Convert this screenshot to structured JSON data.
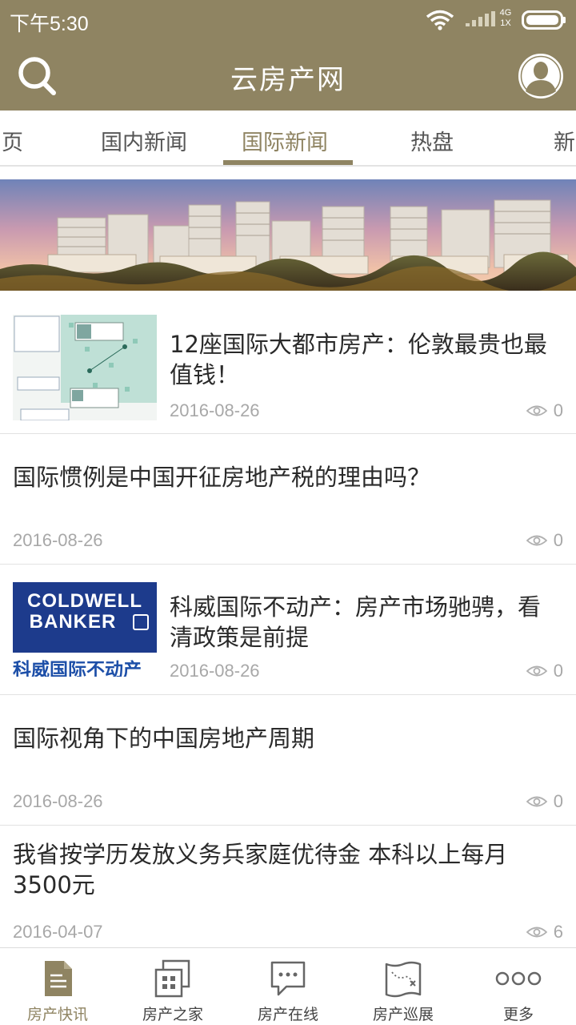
{
  "status_bar": {
    "time": "下午5:30",
    "network_top": "4G",
    "network_bottom": "1X"
  },
  "header": {
    "title": "云房产网",
    "accent_color": "#8f8462"
  },
  "tabs": [
    {
      "label": "页",
      "active": false
    },
    {
      "label": "国内新闻",
      "active": false
    },
    {
      "label": "国际新闻",
      "active": true
    },
    {
      "label": "热盘",
      "active": false
    },
    {
      "label": "新",
      "active": false
    }
  ],
  "news": [
    {
      "title": "12座国际大都市房产：伦敦最贵也最值钱！",
      "date": "2016-08-26",
      "views": "0",
      "thumbnail": "map-infographic"
    },
    {
      "title": "国际惯例是中国开征房地产税的理由吗？",
      "date": "2016-08-26",
      "views": "0"
    },
    {
      "title": "科威国际不动产：房产市场驰骋，看清政策是前提",
      "date": "2016-08-26",
      "views": "0",
      "thumbnail": "coldwell-banker-logo",
      "logo": {
        "line1": "COLDWELL",
        "line2": "BANKER",
        "caption": "科威国际不动产"
      }
    },
    {
      "title": "国际视角下的中国房地产周期",
      "date": "2016-08-26",
      "views": "0"
    },
    {
      "title": "我省按学历发放义务兵家庭优待金 本科以上每月3500元",
      "date": "2016-04-07",
      "views": "6"
    }
  ],
  "bottom_nav": [
    {
      "label": "房产快讯",
      "icon": "document-icon",
      "active": true
    },
    {
      "label": "房产之家",
      "icon": "building-icon",
      "active": false
    },
    {
      "label": "房产在线",
      "icon": "chat-bubble-icon",
      "active": false
    },
    {
      "label": "房产巡展",
      "icon": "map-icon",
      "active": false
    },
    {
      "label": "更多",
      "icon": "more-dots-icon",
      "active": false
    }
  ]
}
